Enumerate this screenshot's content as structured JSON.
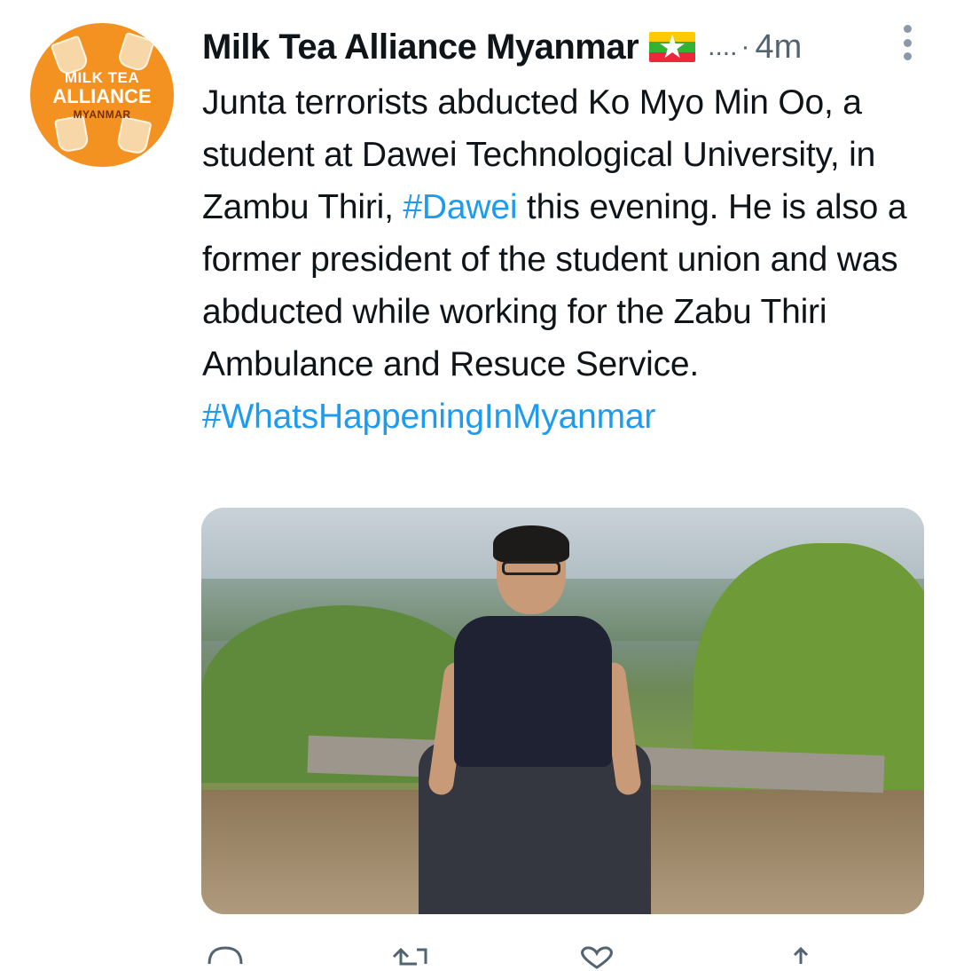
{
  "tweet": {
    "author_name": "Milk Tea Alliance Myanmar",
    "ellipsis": "....",
    "separator": "·",
    "time": "4m",
    "avatar": {
      "line1": "MILK TEA",
      "line2": "ALLIANCE",
      "line3": "MYANMAR"
    },
    "text": {
      "part1": "Junta terrorists abducted Ko Myo Min Oo, a student at Dawei Technological University, in Zambu Thiri, ",
      "hashtag1": "#Dawei",
      "part2": " this evening. He is also a former president of the student union and was abducted while working for the Zabu Thiri Ambulance and Resuce Service. ",
      "hashtag2": "#WhatsHappeningInMyanmar"
    },
    "icons": {
      "flag": "myanmar-flag-icon",
      "more": "more-vertical-icon",
      "reply": "reply-icon",
      "retweet": "retweet-icon",
      "like": "like-icon",
      "share": "share-icon"
    }
  },
  "colors": {
    "hashtag": "#1d9bf0",
    "avatar_bg": "#f39221",
    "secondary_text": "#536471"
  }
}
